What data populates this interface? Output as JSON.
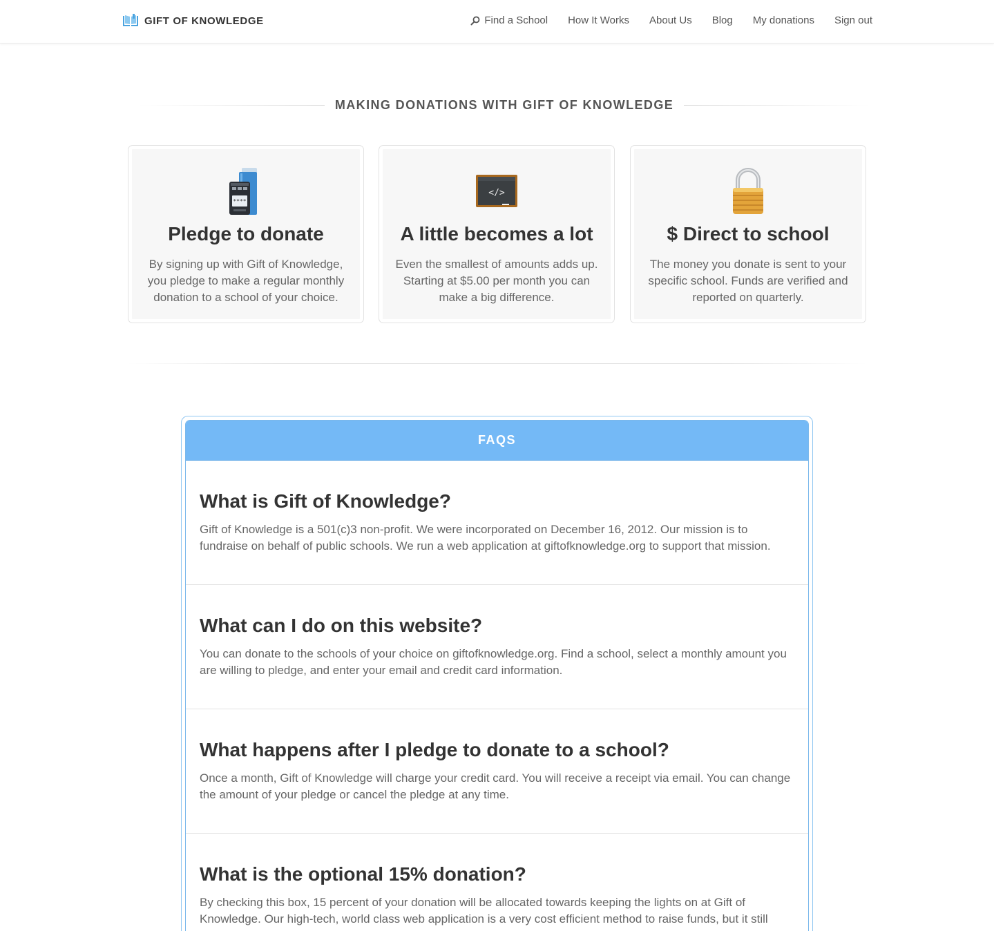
{
  "brand": {
    "name": "GIFT OF KNOWLEDGE",
    "icon": "book-icon",
    "accent": "#4aa3df"
  },
  "nav": [
    {
      "label": "Find a School",
      "icon": "search-icon"
    },
    {
      "label": "How It Works"
    },
    {
      "label": "About Us"
    },
    {
      "label": "Blog"
    },
    {
      "label": "My donations"
    },
    {
      "label": "Sign out"
    }
  ],
  "section": {
    "title": "MAKING DONATIONS WITH GIFT OF KNOWLEDGE"
  },
  "cards": [
    {
      "icon": "calculator-icon",
      "title": "Pledge to donate",
      "text": "By signing up with Gift of Knowledge, you pledge to make a regular monthly donation to a school of your choice."
    },
    {
      "icon": "chalkboard-icon",
      "title": "A little becomes a lot",
      "text": "Even the smallest of amounts adds up. Starting at $5.00 per month you can make a big difference."
    },
    {
      "icon": "padlock-icon",
      "title": "$ Direct to school",
      "text": "The money you donate is sent to your specific school. Funds are verified and reported on quarterly."
    }
  ],
  "faq": {
    "title": "FAQS",
    "header_color": "#74b9f6",
    "items": [
      {
        "q": "What is Gift of Knowledge?",
        "a": "Gift of Knowledge is a 501(c)3 non-profit. We were incorporated on December 16, 2012. Our mission is to fundraise on behalf of public schools. We run a web application at giftofknowledge.org to support that mission."
      },
      {
        "q": "What can I do on this website?",
        "a": "You can donate to the schools of your choice on giftofknowledge.org. Find a school, select a monthly amount you are willing to pledge, and enter your email and credit card information."
      },
      {
        "q": "What happens after I pledge to donate to a school?",
        "a": "Once a month, Gift of Knowledge will charge your credit card. You will receive a receipt via email. You can change the amount of your pledge or cancel the pledge at any time."
      },
      {
        "q": "What is the optional 15% donation?",
        "a": "By checking this box, 15 percent of your donation will be allocated towards keeping the lights on at Gift of Knowledge. Our high-tech, world class web application is a very cost efficient method to raise funds, but it still"
      }
    ]
  }
}
